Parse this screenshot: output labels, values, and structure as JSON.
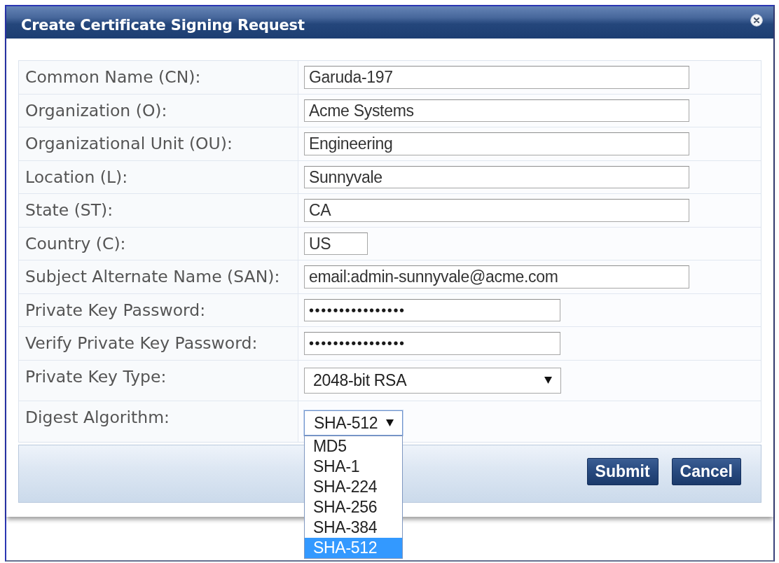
{
  "dialog": {
    "title": "Create Certificate Signing Request"
  },
  "fields": [
    {
      "kind": "text",
      "label": "Common Name (CN):",
      "value": "Garuda-197"
    },
    {
      "kind": "text",
      "label": "Organization (O):",
      "value": "Acme Systems"
    },
    {
      "kind": "text",
      "label": "Organizational Unit (OU):",
      "value": "Engineering"
    },
    {
      "kind": "text",
      "label": "Location (L):",
      "value": "Sunnyvale"
    },
    {
      "kind": "text",
      "label": "State (ST):",
      "value": "CA"
    },
    {
      "kind": "short-text",
      "label": "Country (C):",
      "value": "US"
    },
    {
      "kind": "text",
      "label": "Subject Alternate Name (SAN):",
      "value": "email:admin-sunnyvale@acme.com"
    },
    {
      "kind": "password",
      "label": "Private Key Password:",
      "value": "••••••••••••••••"
    },
    {
      "kind": "password",
      "label": "Verify Private Key Password:",
      "value": "••••••••••••••••"
    },
    {
      "kind": "select",
      "label": "Private Key Type:",
      "value": "2048-bit RSA",
      "expanded": false
    },
    {
      "kind": "compact-select",
      "label": "Digest Algorithm:",
      "value": "SHA-512",
      "expanded": true,
      "options": [
        {
          "label": "MD5",
          "selected": false
        },
        {
          "label": "SHA-1",
          "selected": false
        },
        {
          "label": "SHA-224",
          "selected": false
        },
        {
          "label": "SHA-256",
          "selected": false
        },
        {
          "label": "SHA-384",
          "selected": false
        },
        {
          "label": "SHA-512",
          "selected": true
        }
      ]
    }
  ],
  "buttons": [
    "Submit",
    "Cancel"
  ]
}
